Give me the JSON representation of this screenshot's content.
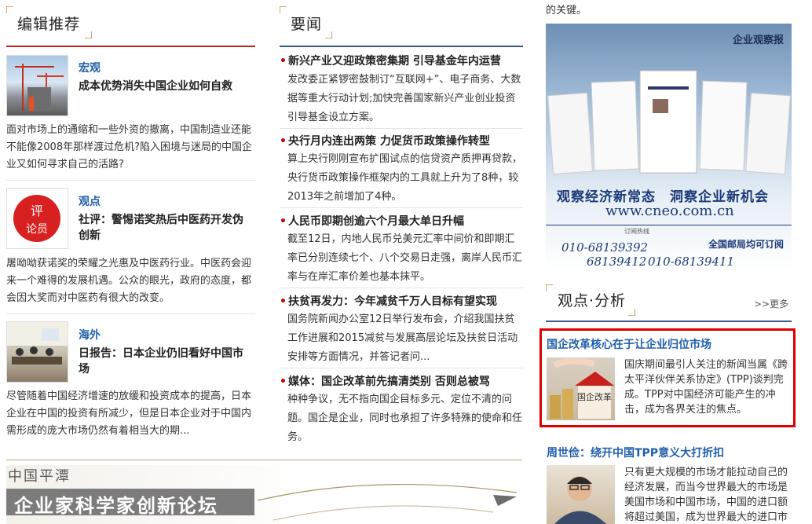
{
  "left": {
    "section_title": "编辑推荐",
    "articles": [
      {
        "category": "宏观",
        "headline": "成本优势消失中国企业如何自救",
        "summary": "面对市场上的通缩和一些外资的撤离，中国制造业还能不能像2008年那样渡过危机?陷入困境与迷局的中国企业又如何寻求自己的活路?"
      },
      {
        "category": "观点",
        "headline": "社评：警惕诺奖热后中医药开发伪创新",
        "summary": "屠呦呦获诺奖的荣耀之光惠及中医药行业。中医药会迎来一个难得的发展机遇。公众的眼光，政府的态度，都会因大奖而对中医药有很大的改变。",
        "stamp_text": "评论员"
      },
      {
        "category": "海外",
        "headline": "日报告：日本企业仍旧看好中国市场",
        "summary": "尽管随着中国经济增速的放缓和投资成本的提高，日本企业在中国的投资有所减少，但是日本企业对于中国内需形成的庞大市场仍然有着相当大的期..."
      }
    ],
    "forum_banner": {
      "org": "中国平潭",
      "title": "企业家科学家创新论坛"
    }
  },
  "middle": {
    "section_title": "要闻",
    "news": [
      {
        "title": "新兴产业又迎政策密集期 引导基金年内运营",
        "body": "发改委正紧锣密鼓制订“互联网+”、电子商务、大数据等重大行动计划;加快完善国家新兴产业创业投资引导基金设立方案。"
      },
      {
        "title": "央行月内连出两策 力促货币政策操作转型",
        "body": "算上央行刚刚宣布扩围试点的信贷资产质押再贷款，央行货币政策操作框架内的工具就上升为了8种，较2013年之前增加了4种。"
      },
      {
        "title": "人民币即期创逾六个月最大单日升幅",
        "body": "截至12日，内地人民币兑美元汇率中间价和即期汇率已分别连续七个、八个交易日走强，离岸人民币汇率与在岸汇率价差也基本抹平。"
      },
      {
        "title": "扶贫再发力：今年减贫千万人目标有望实现",
        "body": "国务院新闻办公室12日举行发布会，介绍我国扶贫工作进展和2015减贫与发展高层论坛及扶贫日活动安排等方面情况，并答记者问..."
      },
      {
        "title": "媒体：国企改革前先搞清类别 否则总被骂",
        "body": "种种争议，无不指向国企目标多元、定位不清的问题。国企是企业，同时也承担了许多特殊的使命和任务。"
      }
    ]
  },
  "right": {
    "top_text": "的关键。",
    "ad": {
      "logo": "企业观察报",
      "slogan": "观察经济新常态　洞察企业新机会",
      "url": "www.cneo.com.cn",
      "phone1": "010-68139392",
      "phone2": "68139412",
      "phone3": "010-68139411",
      "note": "全国邮局均可订阅",
      "small_label": "订阅热线"
    },
    "section_title": "观点·分析",
    "more_label": ">>更多",
    "features": [
      {
        "title": "国企改革核心在于让企业归位市场",
        "text": "国庆期间最引人关注的新闻当属《跨太平洋伙伴关系协定》(TPP)谈判完成。TPP对中国经济可能产生的冲击，成为各界关注的焦点。",
        "image_label": "国企改革"
      },
      {
        "title": "周世俭：绕开中国TPP意义大打折扣",
        "text": "只有更大规模的市场才能拉动自己的经济发展，而当今世界最大的市场是美国市场和中国市场，中国的进口额将超过美国，成为世界最大的进口市场。"
      }
    ]
  },
  "colors": {
    "red_rule": "#b22222",
    "blue_rule": "#3a5a8c",
    "link_blue": "#1f5faa",
    "highlight_box": "#e00000",
    "bullet": "#cc0000"
  }
}
